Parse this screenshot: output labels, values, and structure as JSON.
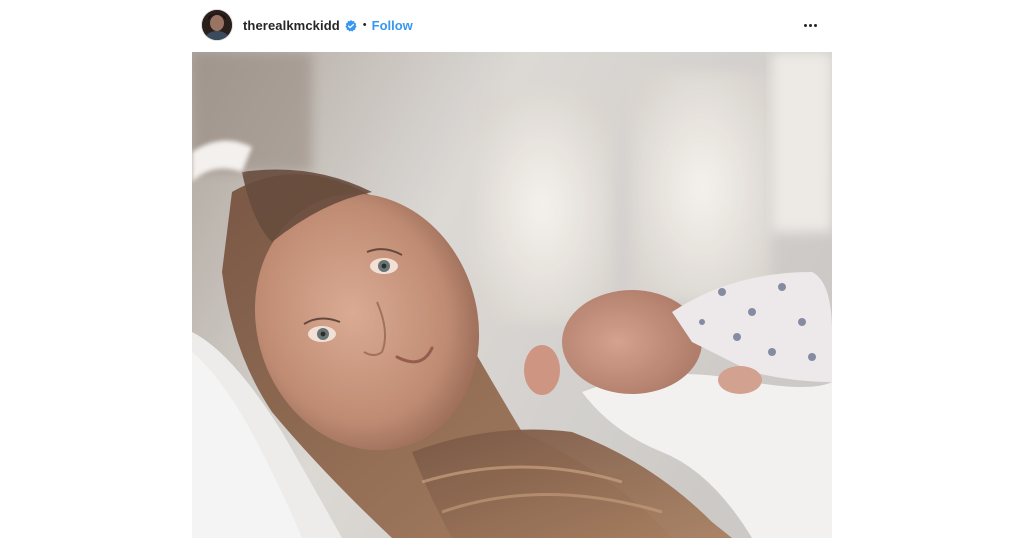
{
  "post": {
    "username": "therealkmckidd",
    "separator": "•",
    "follow_label": "Follow",
    "verified_icon": "verified-badge-icon",
    "more_icon": "more-options-icon"
  },
  "photo": {
    "subject": "post-photo"
  },
  "colors": {
    "follow_blue": "#3897f0",
    "verified_blue": "#3897f0",
    "text_dark": "#262626"
  }
}
